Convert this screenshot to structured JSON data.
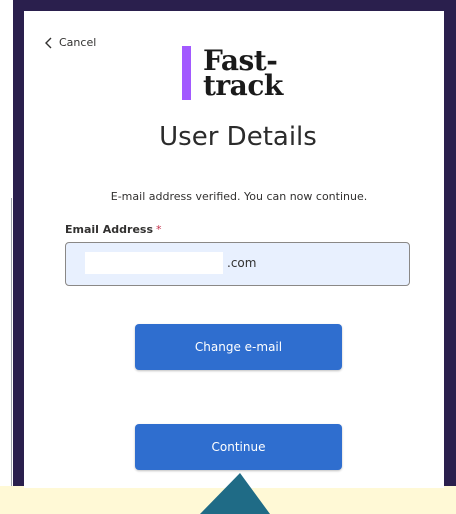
{
  "cancel": {
    "label": "Cancel",
    "icon": "chevron-left-icon"
  },
  "logo": {
    "line1": "Fast-",
    "line2": "track",
    "bar_color": "#a259ff"
  },
  "page": {
    "title": "User Details"
  },
  "status": {
    "message": "E-mail address verified. You can now continue."
  },
  "email": {
    "label": "Email Address",
    "required_mark": "*",
    "value_suffix": ".com"
  },
  "buttons": {
    "change_email": "Change e-mail",
    "continue": "Continue"
  },
  "colors": {
    "frame": "#2a1f4d",
    "button": "#2f6ecf",
    "input_bg": "#e8f0fe",
    "pointer": "#1f6b86"
  }
}
